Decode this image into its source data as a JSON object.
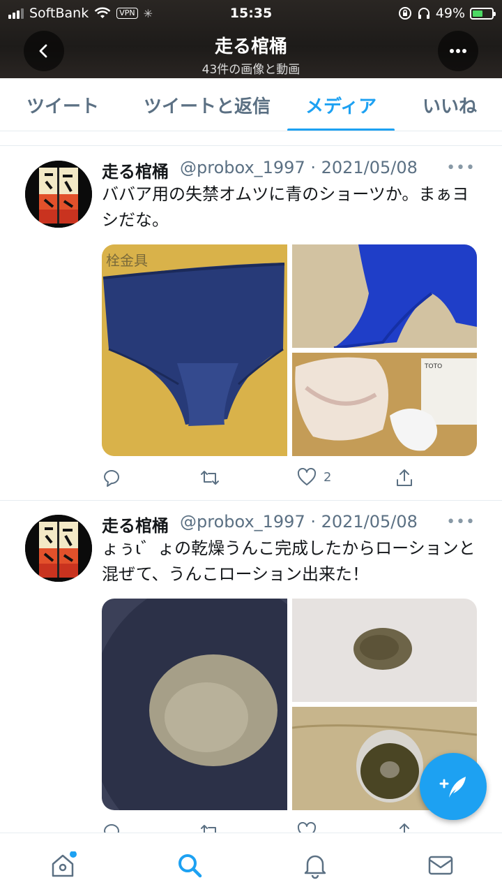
{
  "status_bar": {
    "carrier": "SoftBank",
    "vpn": "VPN",
    "time": "15:35",
    "battery": "49%"
  },
  "header": {
    "title": "走る棺桶",
    "subtitle": "43件の画像と動画"
  },
  "tabs": [
    {
      "label": "ツイート",
      "active": false
    },
    {
      "label": "ツイートと返信",
      "active": false
    },
    {
      "label": "メディア",
      "active": true
    },
    {
      "label": "いいね",
      "active": false
    }
  ],
  "tweets": [
    {
      "name": "走る棺桶",
      "meta": "@probox_1997 · 2021/05/08",
      "text": "ババア用の失禁オムツに青のショーツか。まぁヨシだな。",
      "likes": "2",
      "images": [
        "blue-panties-flat",
        "blue-panties-held",
        "used-diaper-on-box"
      ]
    },
    {
      "name": "走る棺桶",
      "meta": "@probox_1997 · 2021/05/08",
      "text": "ょぅι゛ょの乾燥うんこ完成したからローションと混ぜて、うんこローション出来た！",
      "likes": "",
      "images": [
        "powder-in-bowl",
        "powder-on-paper",
        "liquid-in-cup"
      ]
    }
  ],
  "icons": {
    "back": "chevron-left-icon",
    "more": "more-horizontal-icon",
    "reply": "reply-icon",
    "retweet": "retweet-icon",
    "like": "heart-icon",
    "share": "share-icon",
    "compose": "compose-feather-icon",
    "home": "home-icon",
    "search": "search-icon",
    "notifications": "bell-icon",
    "messages": "mail-icon"
  },
  "colors": {
    "accent": "#1da1f2",
    "secondary_text": "#5b7083",
    "border": "#e6ecf0"
  }
}
